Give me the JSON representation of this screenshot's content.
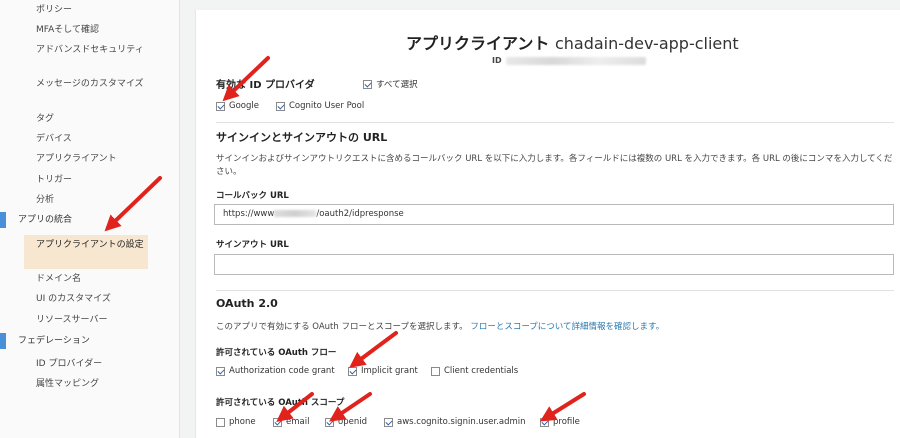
{
  "sidebar": {
    "items": [
      {
        "label": "ポリシー"
      },
      {
        "label": "MFAそして確認"
      },
      {
        "label": "アドバンスドセキュリティ"
      },
      {
        "label": "メッセージのカスタマイズ"
      },
      {
        "label": "タグ"
      },
      {
        "label": "デバイス"
      },
      {
        "label": "アプリクライアント"
      },
      {
        "label": "トリガー"
      },
      {
        "label": "分析"
      }
    ],
    "section_app": "アプリの統合",
    "active_item": "アプリクライアントの設定",
    "app_items": [
      {
        "label": "ドメイン名"
      },
      {
        "label": "UI のカスタマイズ"
      },
      {
        "label": "リソースサーバー"
      }
    ],
    "section_fed": "フェデレーション",
    "fed_items": [
      {
        "label": "ID プロバイダー"
      },
      {
        "label": "属性マッピング"
      }
    ]
  },
  "header": {
    "title": "アプリクライアント",
    "client_name": "chadain-dev-app-client",
    "id_label": "ID"
  },
  "idp": {
    "heading": "有効な ID プロバイダ",
    "select_all": "すべて選択",
    "options": [
      {
        "label": "Google",
        "checked": true
      },
      {
        "label": "Cognito User Pool",
        "checked": true
      }
    ]
  },
  "signin": {
    "heading": "サインインとサインアウトの URL",
    "description": "サインインおよびサインアウトリクエストに含めるコールバック URL を以下に入力します。各フィールドには複数の URL を入力できます。各 URL の後にコンマを入力してください。",
    "callback_label": "コールバック URL",
    "callback_prefix": "https://www",
    "callback_suffix": "/oauth2/idpresponse",
    "signout_label": "サインアウト URL",
    "signout_value": ""
  },
  "oauth": {
    "heading": "OAuth 2.0",
    "description": "このアプリで有効にする OAuth フローとスコープを選択します。",
    "link": "フローとスコープについて詳細情報を確認します。",
    "flows_label": "許可されている OAuth フロー",
    "flows": [
      {
        "label": "Authorization code grant",
        "checked": true
      },
      {
        "label": "Implicit grant",
        "checked": true
      },
      {
        "label": "Client credentials",
        "checked": false
      }
    ],
    "scopes_label": "許可されている OAuth スコープ",
    "scopes": [
      {
        "label": "phone",
        "checked": false
      },
      {
        "label": "email",
        "checked": true
      },
      {
        "label": "openid",
        "checked": true
      },
      {
        "label": "aws.cognito.signin.user.admin",
        "checked": true
      },
      {
        "label": "profile",
        "checked": true
      }
    ]
  },
  "colors": {
    "annotation_arrow": "#e0231c",
    "active_bg": "#f7e7d0",
    "section_marker": "#4a90d9",
    "link": "#2a7ab0"
  }
}
